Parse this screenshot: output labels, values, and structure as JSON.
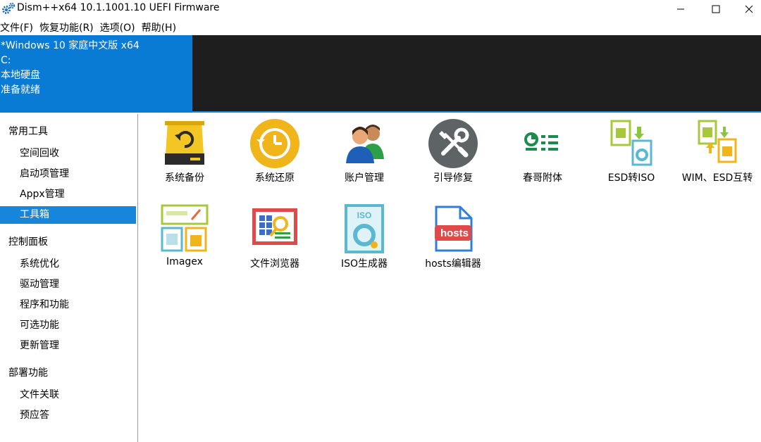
{
  "window": {
    "title": "Dism++x64 10.1.1001.10 UEFI Firmware",
    "controls": {
      "minimize": "—",
      "maximize": "☐",
      "close": "✕"
    }
  },
  "menu": [
    "文件(F)",
    "恢复功能(R)",
    "选项(O)",
    "帮助(H)"
  ],
  "session": {
    "os": "*Windows 10 家庭中文版 x64",
    "drive": "C:",
    "disk": "本地硬盘",
    "status": "准备就绪"
  },
  "sidebar": {
    "groups": [
      {
        "label": "常用工具",
        "items": [
          "空间回收",
          "启动项管理",
          "Appx管理",
          "工具箱"
        ]
      },
      {
        "label": "控制面板",
        "items": [
          "系统优化",
          "驱动管理",
          "程序和功能",
          "可选功能",
          "更新管理"
        ]
      },
      {
        "label": "部署功能",
        "items": [
          "文件关联",
          "预应答"
        ]
      }
    ],
    "selected": "工具箱"
  },
  "tools": [
    {
      "label": "系统备份",
      "icon": "backup-drive-icon"
    },
    {
      "label": "系统还原",
      "icon": "restore-clock-icon"
    },
    {
      "label": "账户管理",
      "icon": "users-icon"
    },
    {
      "label": "引导修复",
      "icon": "tools-icon"
    },
    {
      "label": "春哥附体",
      "icon": "settings-list-icon"
    },
    {
      "label": "ESD转ISO",
      "icon": "esd-to-iso-icon"
    },
    {
      "label": "WIM、ESD互转",
      "icon": "wim-esd-convert-icon"
    },
    {
      "label": "Imagex",
      "icon": "imagex-icon"
    },
    {
      "label": "文件浏览器",
      "icon": "file-browser-icon"
    },
    {
      "label": "ISO生成器",
      "icon": "iso-generator-icon"
    },
    {
      "label": "hosts编辑器",
      "icon": "hosts-editor-icon"
    }
  ],
  "hosts_icon_text": "hosts",
  "colors": {
    "accent": "#0a7bd4",
    "selected": "#1785d9",
    "dark_panel": "#1e1e1e"
  }
}
